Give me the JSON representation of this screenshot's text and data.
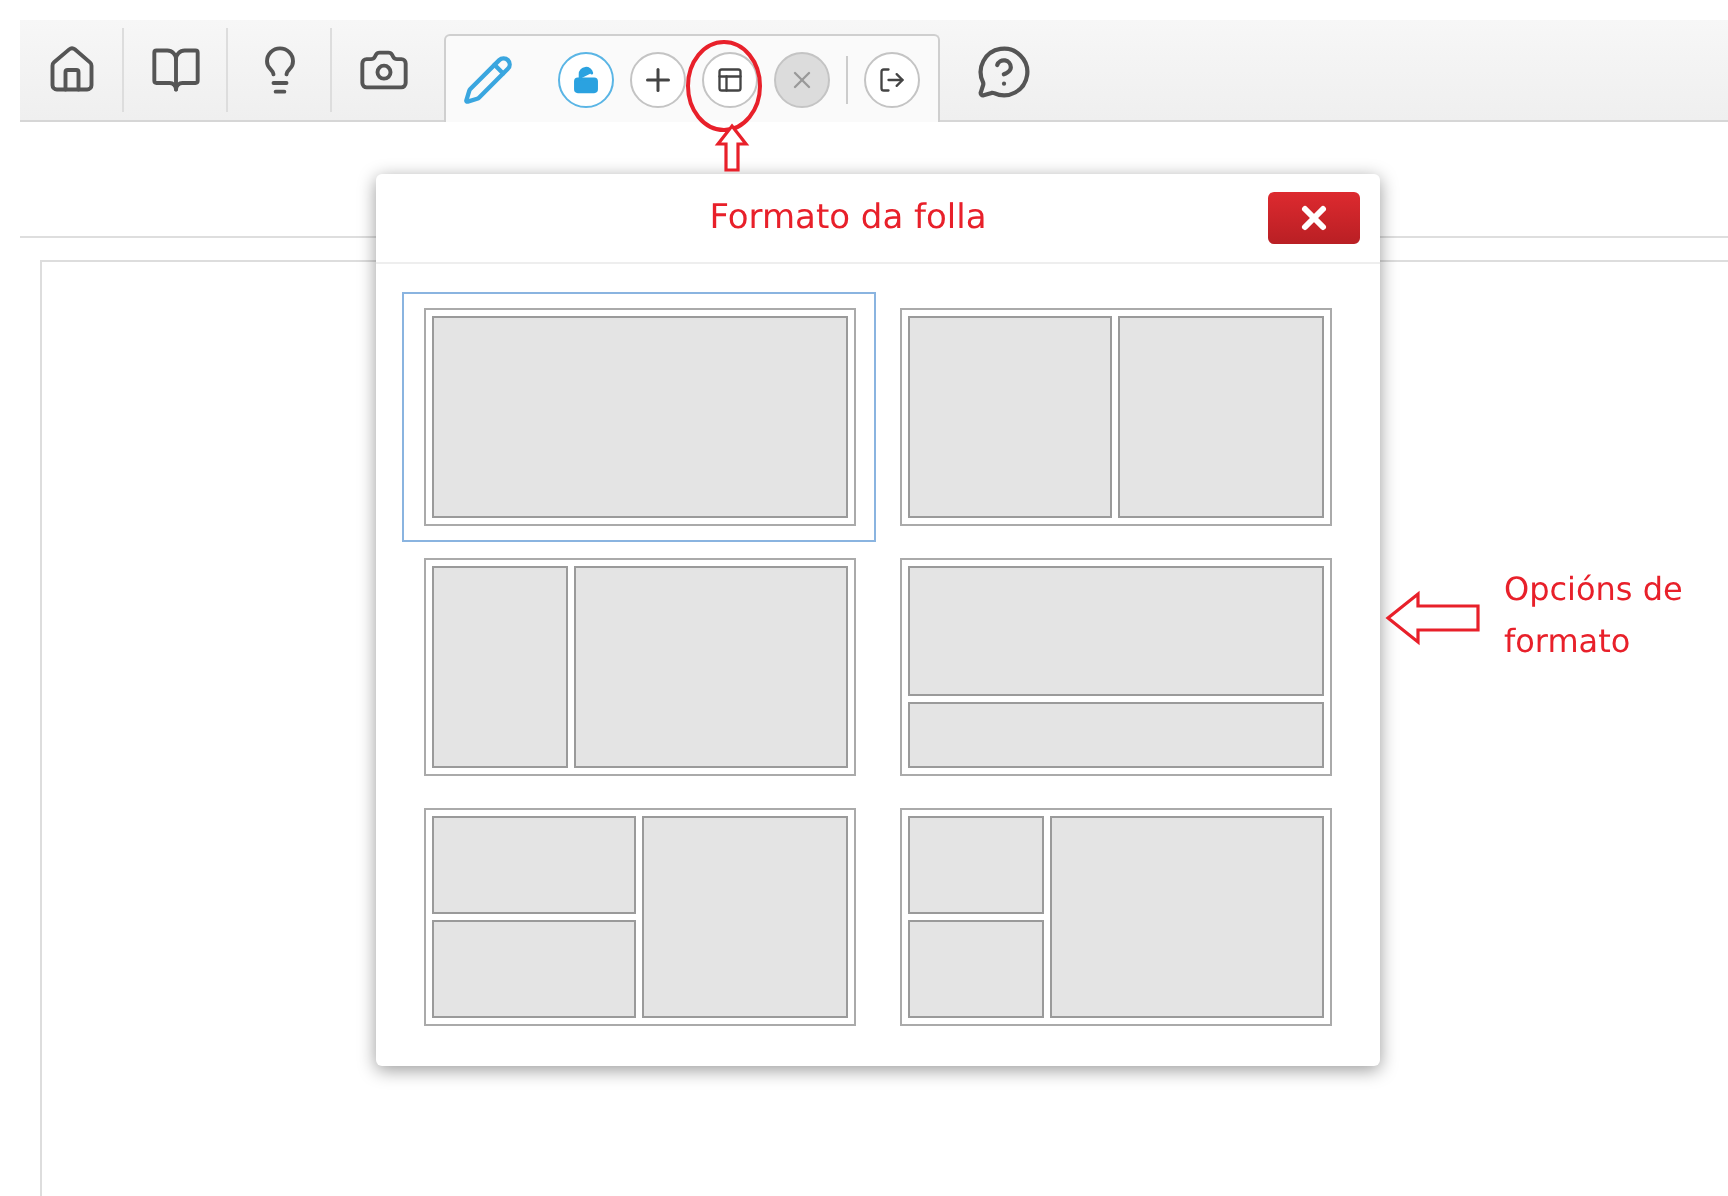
{
  "toolbar": {
    "tabs": [
      {
        "kind": "home",
        "selected": false
      },
      {
        "kind": "book",
        "selected": false
      },
      {
        "kind": "idea",
        "selected": false
      },
      {
        "kind": "camera",
        "selected": false
      },
      {
        "kind": "edit",
        "selected": true
      }
    ]
  },
  "edit_tools": [
    {
      "kind": "lock",
      "on": true,
      "disabled": false
    },
    {
      "kind": "add",
      "on": false,
      "disabled": false
    },
    {
      "kind": "layout",
      "on": false,
      "disabled": false
    },
    {
      "kind": "delete",
      "on": false,
      "disabled": true
    },
    {
      "kind": "exit",
      "on": false,
      "disabled": false
    }
  ],
  "dialog": {
    "title": "Formato da folla",
    "layouts": [
      {
        "kind": "single",
        "selected": true
      },
      {
        "kind": "two-columns",
        "selected": false
      },
      {
        "kind": "sidebar-left",
        "selected": false
      },
      {
        "kind": "top-bottom",
        "selected": false
      },
      {
        "kind": "left-stacked",
        "selected": false
      },
      {
        "kind": "narrow-left-stacked",
        "selected": false
      }
    ]
  },
  "annotation": {
    "callout": "Opcións de formato"
  }
}
